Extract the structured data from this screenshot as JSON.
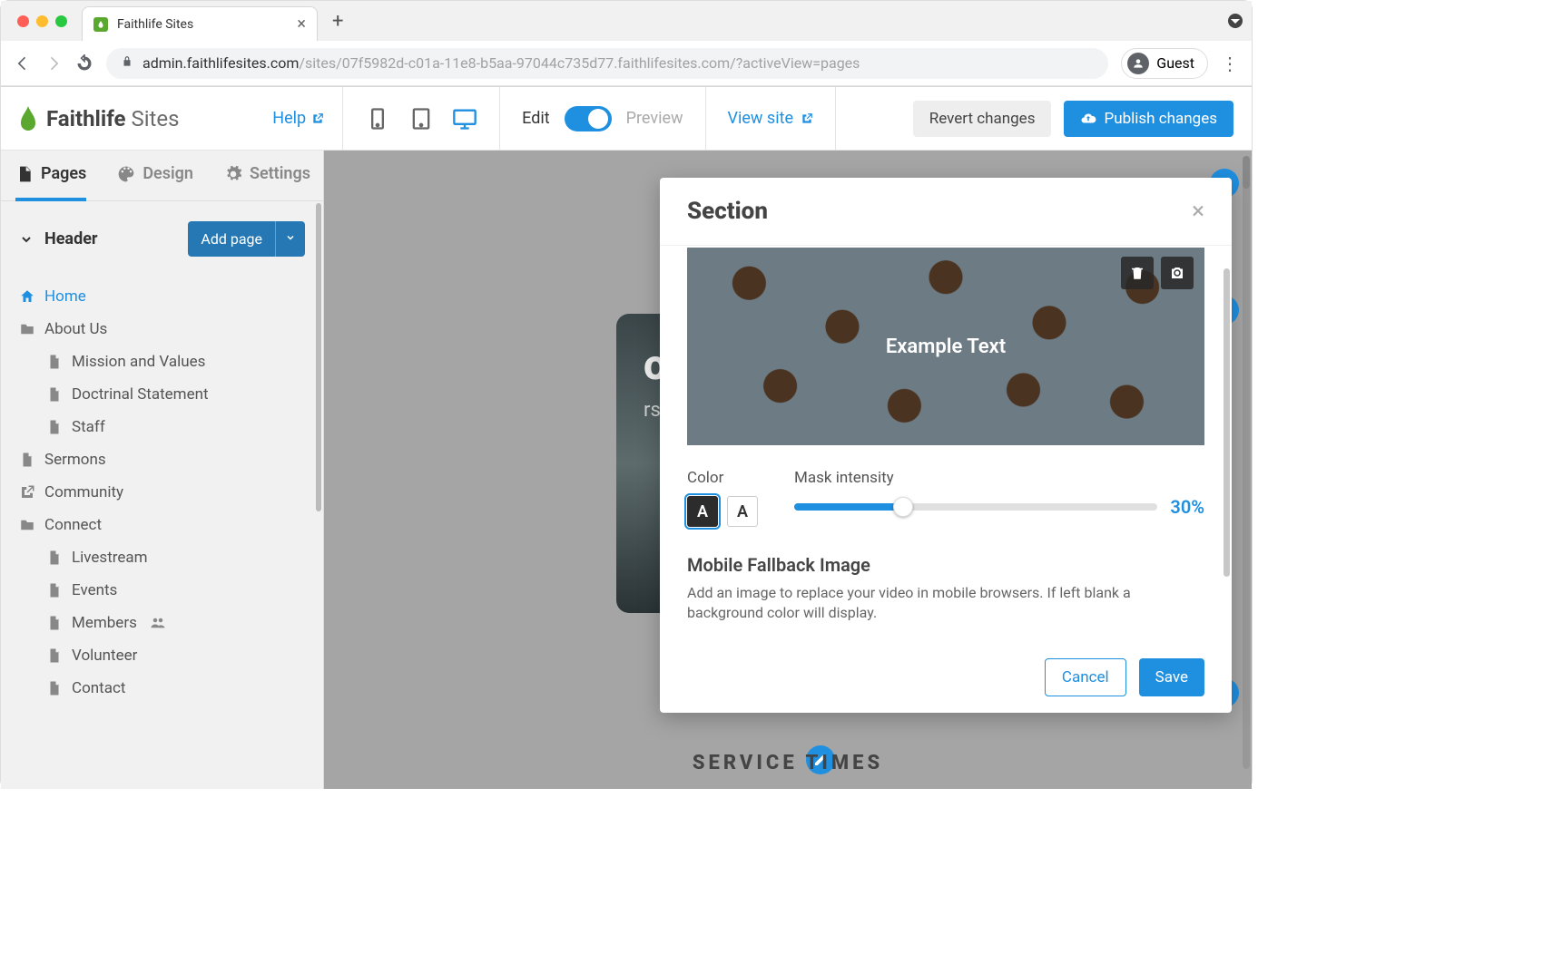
{
  "browser": {
    "tab_title": "Faithlife Sites",
    "url_host": "admin.faithlifesites.com",
    "url_path": "/sites/07f5982d-c01a-11e8-b5aa-97044c735d77.faithlifesites.com/?activeView=pages",
    "guest_label": "Guest"
  },
  "app": {
    "brand_bold": "Faithlife",
    "brand_light": "Sites",
    "help": "Help",
    "edit": "Edit",
    "preview": "Preview",
    "view_site": "View site",
    "revert": "Revert changes",
    "publish": "Publish changes"
  },
  "sidebar": {
    "tabs": {
      "pages": "Pages",
      "design": "Design",
      "settings": "Settings"
    },
    "header": "Header",
    "add_page": "Add page",
    "tree": [
      {
        "label": "Home",
        "icon": "home",
        "active": true
      },
      {
        "label": "About Us",
        "icon": "folder"
      },
      {
        "label": "Mission and Values",
        "icon": "file",
        "lvl": 2
      },
      {
        "label": "Doctrinal Statement",
        "icon": "file",
        "lvl": 2
      },
      {
        "label": "Staff",
        "icon": "file",
        "lvl": 2
      },
      {
        "label": "Sermons",
        "icon": "file"
      },
      {
        "label": "Community",
        "icon": "external"
      },
      {
        "label": "Connect",
        "icon": "folder"
      },
      {
        "label": "Livestream",
        "icon": "file",
        "lvl": 2
      },
      {
        "label": "Events",
        "icon": "file",
        "lvl": 2
      },
      {
        "label": "Members",
        "icon": "file",
        "lvl": 2,
        "badge": "people"
      },
      {
        "label": "Volunteer",
        "icon": "file",
        "lvl": 2
      },
      {
        "label": "Contact",
        "icon": "file",
        "lvl": 2
      }
    ]
  },
  "canvas": {
    "hero_title": "one Church",
    "hero_sub": "rson and live stream",
    "service_title": "SERVICE TIMES"
  },
  "modal": {
    "title": "Section",
    "example_text": "Example Text",
    "color_label": "Color",
    "mask_label": "Mask intensity",
    "mask_value": "30%",
    "fallback_title": "Mobile Fallback Image",
    "fallback_desc": "Add an image to replace your video in mobile browsers. If left blank a background color will display.",
    "cancel": "Cancel",
    "save": "Save",
    "swatch_letter": "A"
  }
}
